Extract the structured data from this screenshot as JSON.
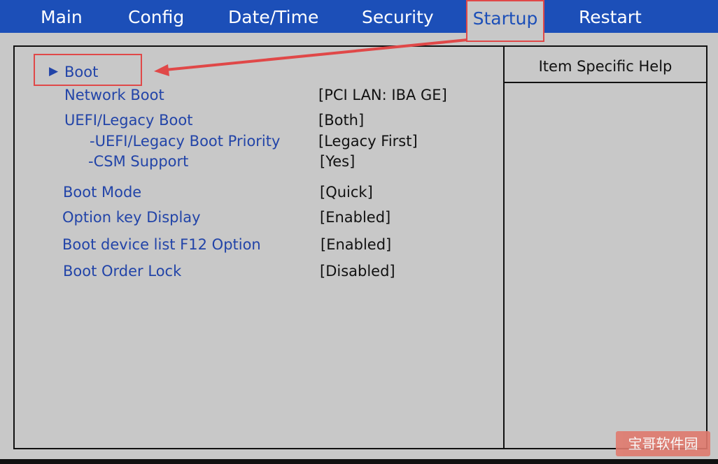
{
  "menu": {
    "tabs": [
      {
        "label": "Main"
      },
      {
        "label": "Config"
      },
      {
        "label": "Date/Time"
      },
      {
        "label": "Security"
      },
      {
        "label": "Startup"
      },
      {
        "label": "Restart"
      }
    ],
    "active_tab": "Startup"
  },
  "main": {
    "items": [
      {
        "label": "Boot",
        "value": "",
        "submenu_marker": "▶"
      },
      {
        "label": "Network Boot",
        "value": "[PCI LAN: IBA GE]"
      },
      {
        "label": "UEFI/Legacy Boot",
        "value": "[Both]"
      },
      {
        "label": "-UEFI/Legacy Boot Priority",
        "value": "[Legacy First]"
      },
      {
        "label": "-CSM Support",
        "value": "[Yes]"
      },
      {
        "label": "Boot Mode",
        "value": "[Quick]"
      },
      {
        "label": "Option key Display",
        "value": "[Enabled]"
      },
      {
        "label": "Boot device list F12 Option",
        "value": "[Enabled]"
      },
      {
        "label": "Boot Order Lock",
        "value": "[Disabled]"
      }
    ]
  },
  "help": {
    "title": "Item Specific Help"
  },
  "watermark": "宝哥软件园",
  "colors": {
    "menubar": "#1c4fb8",
    "panel": "#c8c8c8",
    "item_label": "#2244a8",
    "highlight": "#e04848"
  }
}
